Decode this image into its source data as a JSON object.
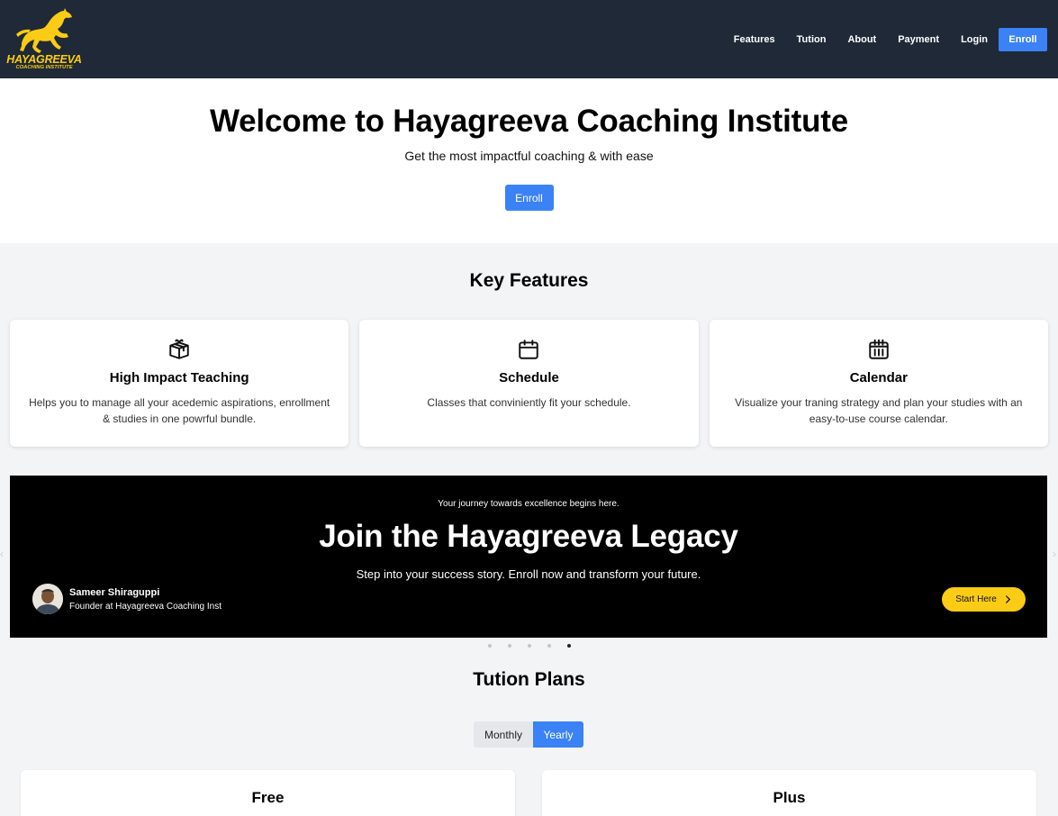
{
  "brand": {
    "title": "HAYAGREEVA",
    "subtitle": "COACHING INSTITUTE",
    "color": "#facc15"
  },
  "nav": {
    "links": [
      "Features",
      "Tution",
      "About",
      "Payment",
      "Login"
    ],
    "enroll": "Enroll"
  },
  "hero": {
    "title": "Welcome to Hayagreeva Coaching Institute",
    "subtitle": "Get the most impactful coaching & with ease",
    "button": "Enroll"
  },
  "features": {
    "title": "Key Features",
    "cards": [
      {
        "icon": "gift-box-icon",
        "title": "High Impact Teaching",
        "description": "Helps you to manage all your acedemic aspirations, enrollment & studies in one powrful bundle."
      },
      {
        "icon": "calendar-icon",
        "title": "Schedule",
        "description": "Classes that conviniently fit your schedule."
      },
      {
        "icon": "calendar-grid-icon",
        "title": "Calendar",
        "description": "Visualize your traning strategy and plan your studies with an easy-to-use course calendar."
      }
    ]
  },
  "banner": {
    "kicker": "Your journey towards excellence begins here.",
    "title": "Join the Hayagreeva Legacy",
    "subtitle": "Step into your success story. Enroll now and transform your future.",
    "founder_name": "Sameer Shiraguppi",
    "founder_role": "Founder at Hayagreeva Coaching Inst",
    "cta": "Start Here",
    "slide_count": 5,
    "active_slide": 5
  },
  "plans": {
    "title": "Tution Plans",
    "toggle": {
      "monthly": "Monthly",
      "yearly": "Yearly",
      "selected": "Yearly"
    },
    "cards": [
      "Free",
      "Plus"
    ]
  },
  "colors": {
    "navbar": "#1f2937",
    "accent": "#3b82f6",
    "cta": "#facc15"
  }
}
